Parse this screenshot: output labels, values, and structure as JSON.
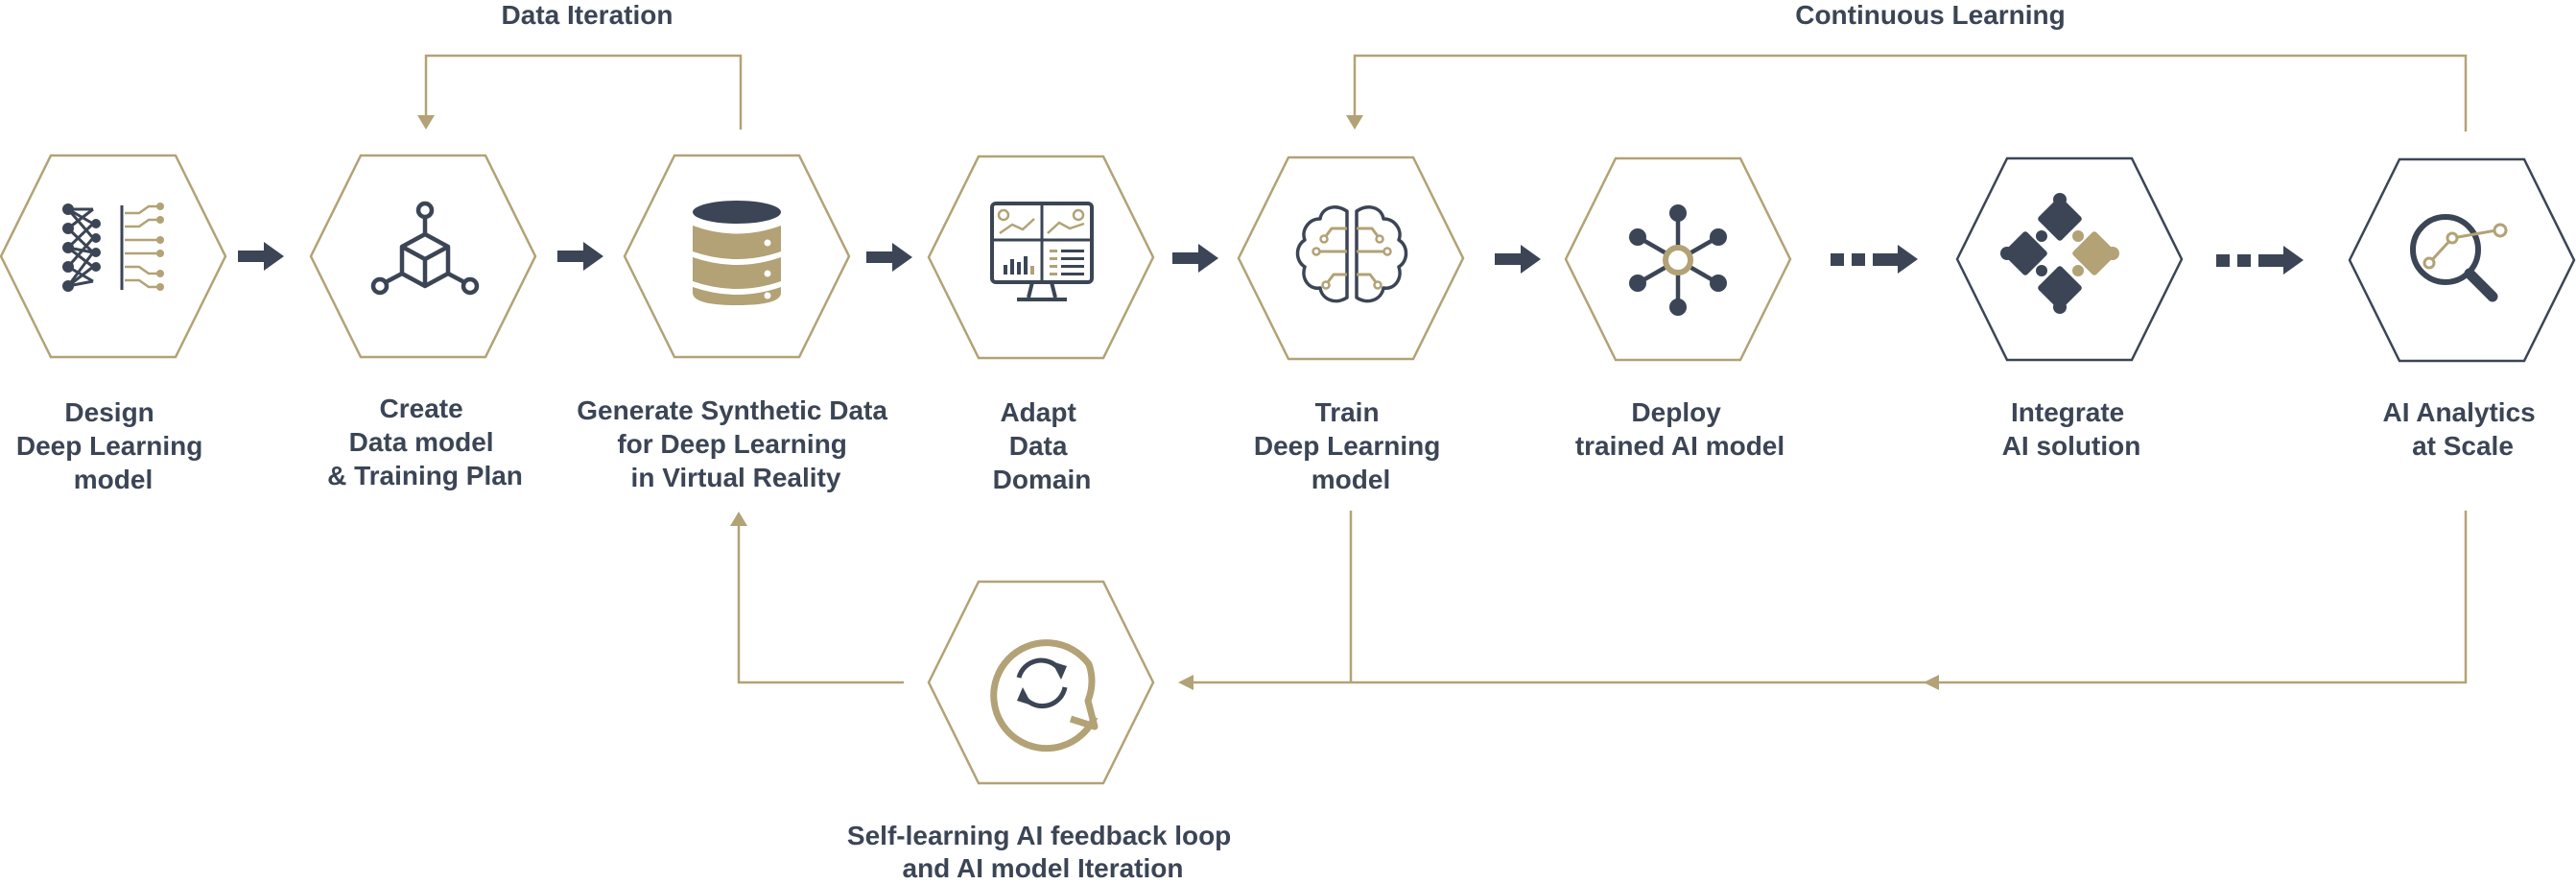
{
  "colors": {
    "gold": "#b2a276",
    "navy": "#3b4555",
    "background": "#ffffff"
  },
  "loops": {
    "data_iteration": "Data Iteration",
    "continuous_learning": "Continuous Learning"
  },
  "steps": [
    {
      "id": "design",
      "icon": "neural-network-icon",
      "lines": [
        "Design",
        "Deep Learning",
        "model"
      ]
    },
    {
      "id": "create",
      "icon": "data-model-cube-icon",
      "lines": [
        "Create",
        "Data model",
        "& Training Plan"
      ]
    },
    {
      "id": "generate",
      "icon": "database-icon",
      "lines": [
        "Generate Synthetic Data",
        "for Deep Learning",
        "in Virtual Reality"
      ]
    },
    {
      "id": "adapt",
      "icon": "dashboard-monitor-icon",
      "lines": [
        "Adapt",
        "Data",
        "Domain"
      ]
    },
    {
      "id": "train",
      "icon": "brain-circuit-icon",
      "lines": [
        "Train",
        "Deep Learning",
        "model"
      ]
    },
    {
      "id": "deploy",
      "icon": "network-hub-icon",
      "lines": [
        "Deploy",
        "trained AI model"
      ]
    },
    {
      "id": "integrate",
      "icon": "puzzle-icon",
      "lines": [
        "Integrate",
        "AI solution"
      ]
    },
    {
      "id": "analytics",
      "icon": "magnifier-analytics-icon",
      "lines": [
        "AI Analytics",
        "at Scale"
      ]
    }
  ],
  "feedback": {
    "icon": "refresh-chat-icon",
    "lines": [
      "Self-learning AI feedback loop",
      "and AI model Iteration"
    ]
  }
}
